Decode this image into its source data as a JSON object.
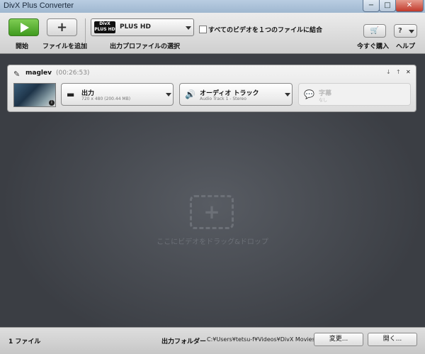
{
  "window": {
    "title": "DivX Plus Converter",
    "min": "−",
    "max": "□",
    "close": "✕"
  },
  "toolbar": {
    "start_label": "開始",
    "add_label": "ファイルを追加",
    "add_glyph": "+",
    "profile": {
      "logo_line1": "DivX",
      "logo_line2": "PLUS HD",
      "name": "PLUS HD",
      "label": "出力プロファイルの選択"
    },
    "merge_label": "すべてのビデオを１つのファイルに結合",
    "buy_label": "今すぐ購入",
    "help_label": "ヘルプ",
    "help_glyph": "?"
  },
  "job": {
    "name": "maglev",
    "duration": "(00:26:53)",
    "output": {
      "title": "出力",
      "detail": "720 x 480 (200.44 MB)"
    },
    "audio": {
      "title": "オーディオ トラック",
      "detail": "Audio Track 1 - Stereo"
    },
    "subtitle": {
      "title": "字幕",
      "detail": "なし"
    }
  },
  "main": {
    "drop_hint": "ここにビデオをドラッグ&ドロップ",
    "drop_glyph": "+"
  },
  "status": {
    "file_count": "1 ファイル",
    "output_folder_label": "出力フォルダー",
    "output_path": "C:¥Users¥tetsu-f¥Videos¥DivX Movies",
    "change_button": "変更...",
    "open_button": "開く..."
  }
}
